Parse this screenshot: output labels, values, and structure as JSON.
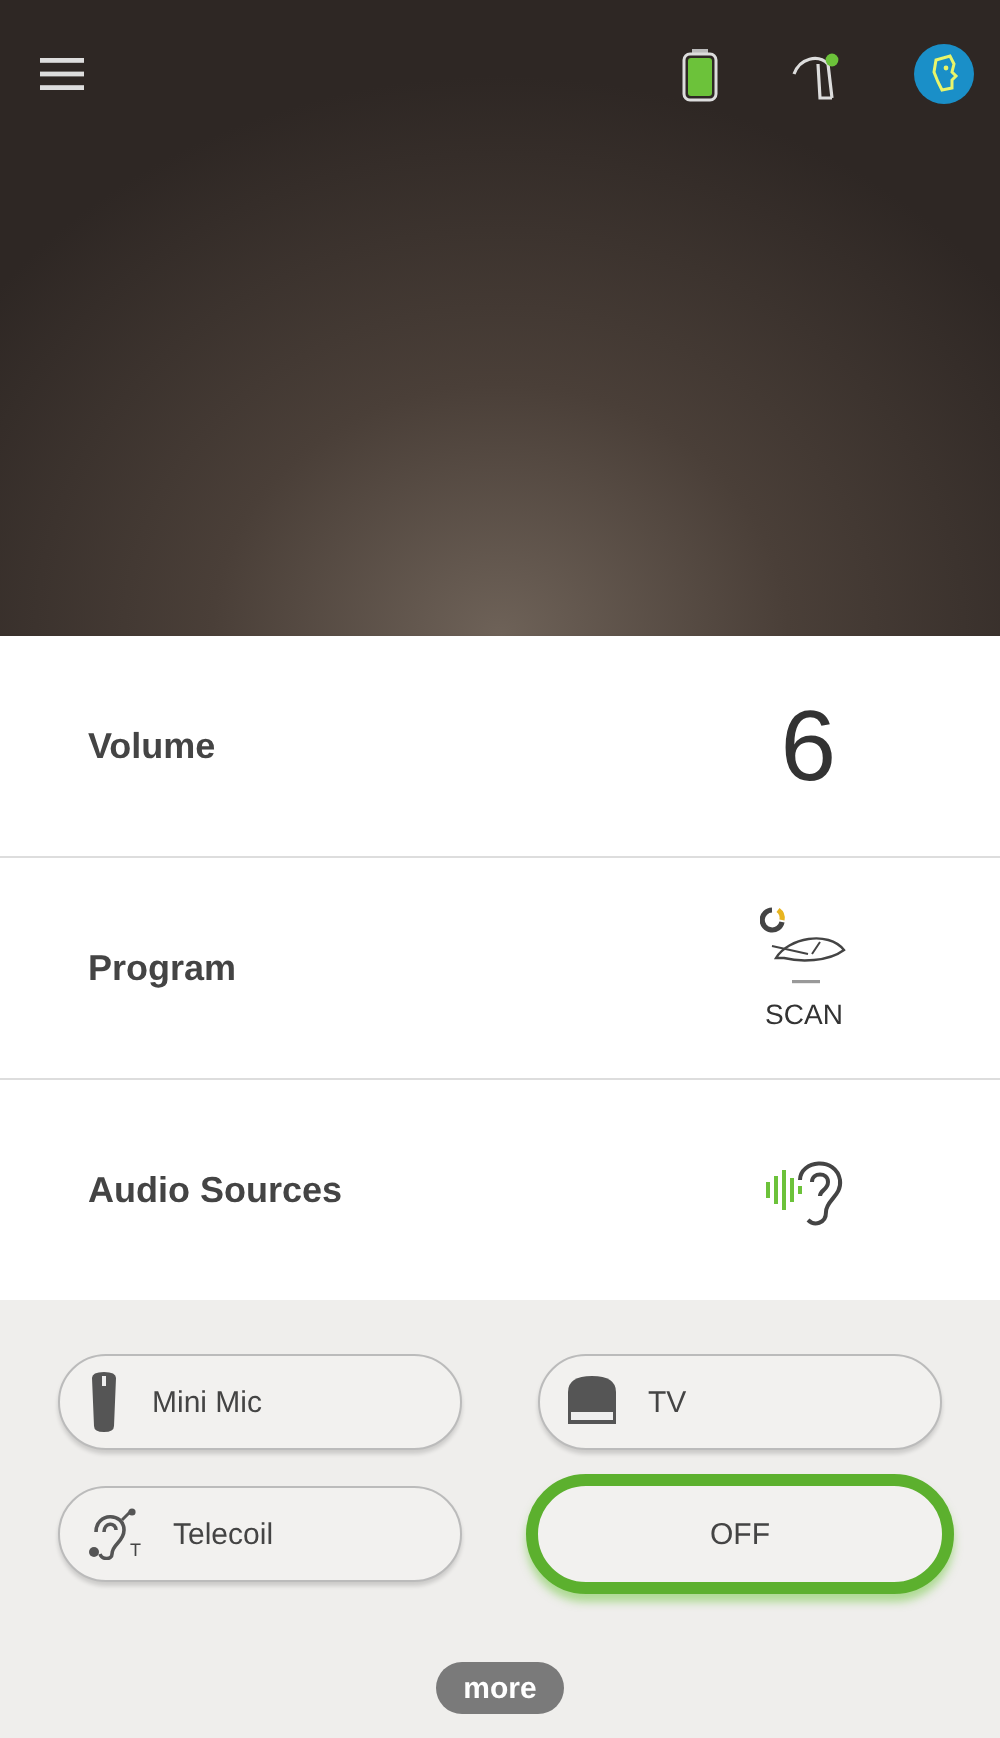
{
  "header": {
    "hearing_aid_connected": true
  },
  "settings": [
    {
      "kind": "volume",
      "label": "Volume",
      "value": "6"
    },
    {
      "kind": "program",
      "label": "Program",
      "value": "SCAN"
    },
    {
      "kind": "audio",
      "label": "Audio Sources"
    }
  ],
  "sources": [
    {
      "kind": "mic",
      "label": "Mini Mic",
      "selected": false
    },
    {
      "kind": "tv",
      "label": "TV",
      "selected": false
    },
    {
      "kind": "telecoil",
      "label": "Telecoil",
      "badge": "T",
      "selected": false
    },
    {
      "kind": "off",
      "label": "OFF",
      "selected": true
    }
  ],
  "more_button": "more"
}
